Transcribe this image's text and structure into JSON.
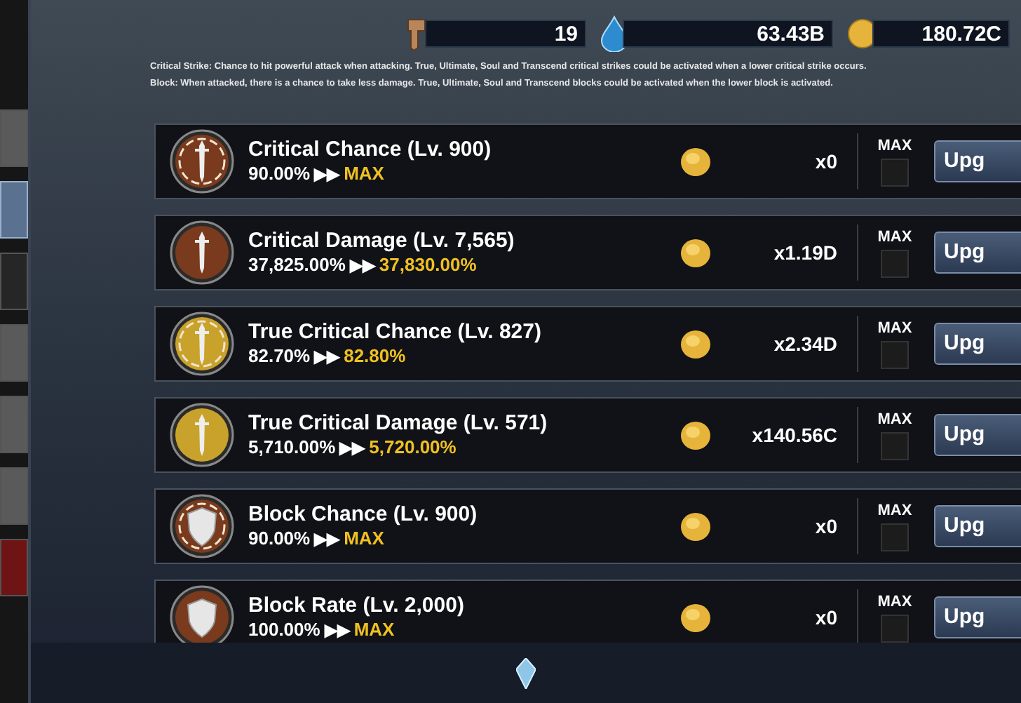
{
  "side_tabs": [
    {
      "selected": false,
      "color": "#5a5a5a"
    },
    {
      "selected": true,
      "color": "#5a7190"
    },
    {
      "selected": false,
      "color": "#262626"
    },
    {
      "selected": false,
      "color": "#5a5a5a"
    },
    {
      "selected": false,
      "color": "#5a5a5a"
    },
    {
      "selected": false,
      "color": "#5a5a5a"
    },
    {
      "selected": false,
      "color": "#6e1414"
    }
  ],
  "currencies": [
    {
      "kind": "key",
      "amount": "19"
    },
    {
      "kind": "gem",
      "amount": "63.43B"
    },
    {
      "kind": "coin",
      "amount": "180.72C"
    }
  ],
  "description": [
    "Critical Strike: Chance to hit powerful attack when attacking. True, Ultimate, Soul and Transcend critical strikes could be activated when a lower critical strike occurs.",
    "Block: When attacked, there is a chance to take less damage. True, Ultimate, Soul and Transcend blocks could be activated when the lower block is activated."
  ],
  "upgrades": [
    {
      "kind": "sword",
      "ring": true,
      "color": "#7a3a1e",
      "title": "Critical Chance (Lv. 900)",
      "current": "90.00%",
      "arrow": "▶▶",
      "next": "MAX",
      "cost": "x0",
      "max_label": "MAX",
      "max_checked": false,
      "button": "Upg"
    },
    {
      "kind": "sword",
      "ring": false,
      "color": "#7a3a1e",
      "title": "Critical Damage (Lv. 7,565)",
      "current": "37,825.00%",
      "arrow": "▶▶",
      "next": "37,830.00%",
      "cost": "x1.19D",
      "max_label": "MAX",
      "max_checked": false,
      "button": "Upg"
    },
    {
      "kind": "sword",
      "ring": true,
      "color": "#c9a22c",
      "title": "True Critical Chance (Lv. 827)",
      "current": "82.70%",
      "arrow": "▶▶",
      "next": "82.80%",
      "cost": "x2.34D",
      "max_label": "MAX",
      "max_checked": false,
      "button": "Upg"
    },
    {
      "kind": "sword",
      "ring": false,
      "color": "#c9a22c",
      "title": "True Critical Damage (Lv. 571)",
      "current": "5,710.00%",
      "arrow": "▶▶",
      "next": "5,720.00%",
      "cost": "x140.56C",
      "max_label": "MAX",
      "max_checked": false,
      "button": "Upg"
    },
    {
      "kind": "shield",
      "ring": true,
      "color": "#7a3a1e",
      "title": "Block Chance (Lv. 900)",
      "current": "90.00%",
      "arrow": "▶▶",
      "next": "MAX",
      "cost": "x0",
      "max_label": "MAX",
      "max_checked": false,
      "button": "Upg"
    },
    {
      "kind": "shield",
      "ring": false,
      "color": "#7a3a1e",
      "title": "Block Rate (Lv. 2,000)",
      "current": "100.00%",
      "arrow": "▶▶",
      "next": "MAX",
      "cost": "x0",
      "max_label": "MAX",
      "max_checked": false,
      "button": "Upg"
    }
  ]
}
